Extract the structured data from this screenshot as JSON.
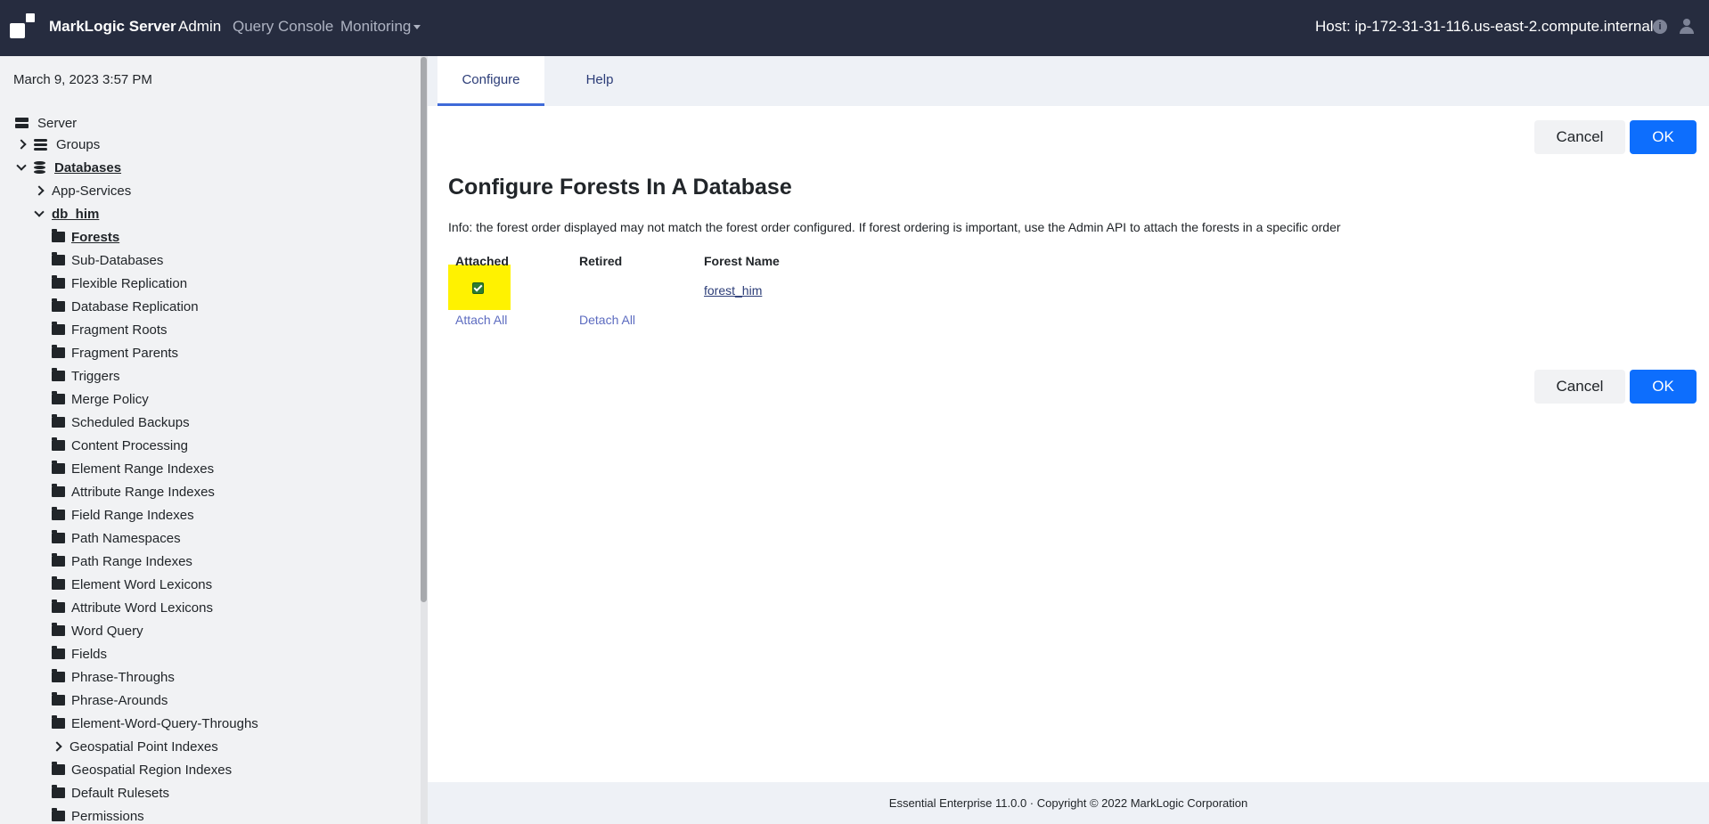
{
  "header": {
    "brand": "MarkLogic Server",
    "nav": {
      "admin": "Admin",
      "query_console": "Query Console",
      "monitoring": "Monitoring"
    },
    "host": "Host: ip-172-31-31-116.us-east-2.compute.internal",
    "info_glyph": "i"
  },
  "sidebar": {
    "datetime": "March 9, 2023 3:57 PM",
    "server": "Server",
    "groups": "Groups",
    "databases": "Databases",
    "app_services": "App-Services",
    "db_him": "db_him",
    "db_items": [
      "Forests",
      "Sub-Databases",
      "Flexible Replication",
      "Database Replication",
      "Fragment Roots",
      "Fragment Parents",
      "Triggers",
      "Merge Policy",
      "Scheduled Backups",
      "Content Processing",
      "Element Range Indexes",
      "Attribute Range Indexes",
      "Field Range Indexes",
      "Path Namespaces",
      "Path Range Indexes",
      "Element Word Lexicons",
      "Attribute Word Lexicons",
      "Word Query",
      "Fields",
      "Phrase-Throughs",
      "Phrase-Arounds",
      "Element-Word-Query-Throughs",
      "Geospatial Point Indexes",
      "Geospatial Region Indexes",
      "Default Rulesets",
      "Permissions"
    ]
  },
  "tabs": {
    "configure": "Configure",
    "help": "Help"
  },
  "buttons": {
    "cancel": "Cancel",
    "ok": "OK"
  },
  "content": {
    "title": "Configure Forests In A Database",
    "info": "Info: the forest order displayed may not match the forest order configured. If forest ordering is important, use the Admin API to attach the forests in a specific order",
    "columns": {
      "attached": "Attached",
      "retired": "Retired",
      "forest_name": "Forest Name"
    },
    "forest": {
      "name": "forest_him",
      "attached": true
    },
    "attach_all": "Attach All",
    "detach_all": "Detach All"
  },
  "footer": {
    "text": "Essential Enterprise 11.0.0 · Copyright © 2022 MarkLogic Corporation"
  },
  "colors": {
    "header_bg": "#262c3f",
    "primary": "#0d6efd",
    "highlight": "#fff200",
    "tab_active": "#3f6ad8"
  }
}
